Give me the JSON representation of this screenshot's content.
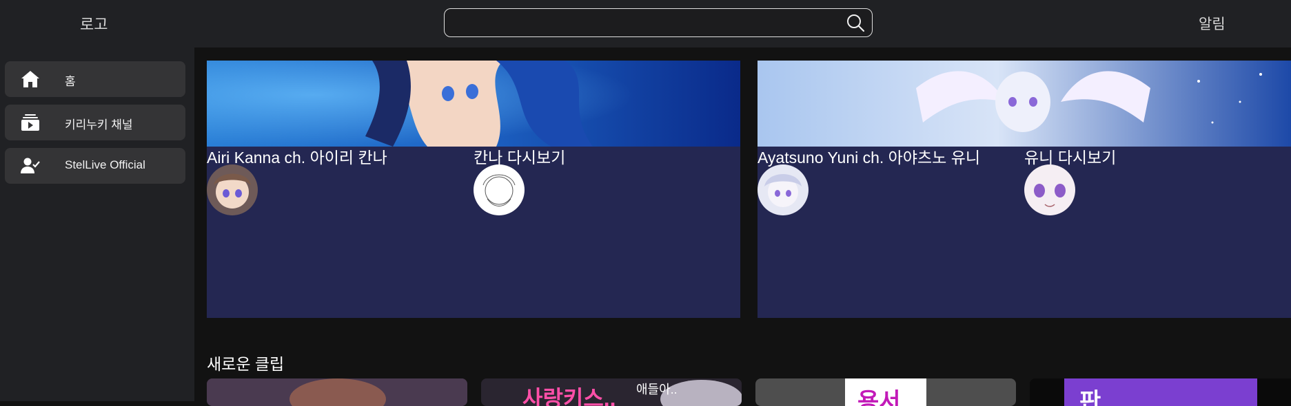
{
  "header": {
    "logo": "로고",
    "search": {
      "value": "",
      "placeholder": ""
    },
    "notifications": "알림"
  },
  "sidebar": {
    "items": [
      {
        "label": "홈",
        "icon": "home-icon"
      },
      {
        "label": "키리누키 채널",
        "icon": "video-channel-icon"
      },
      {
        "label": "StelLive Official",
        "icon": "verified-user-icon"
      }
    ]
  },
  "streamers": [
    {
      "channel": "Airi Kanna ch. 아이리 칸나",
      "replay": "칸나 다시보기"
    },
    {
      "channel": "Ayatsuno Yuni ch. 아야츠노 유니",
      "replay": "유니 다시보기"
    }
  ],
  "clips_section": {
    "title": "새로운 클립",
    "clips": [
      {
        "thumb_text": ""
      },
      {
        "thumb_text": "사랑키스..",
        "thumb_subtext": "애들아.."
      },
      {
        "thumb_text": "용서"
      },
      {
        "thumb_text": "판"
      }
    ]
  },
  "colors": {
    "background": "#121212",
    "topbar": "#202124",
    "sidebar_item": "#343436",
    "card": "#242752",
    "text": "#ffffff"
  }
}
